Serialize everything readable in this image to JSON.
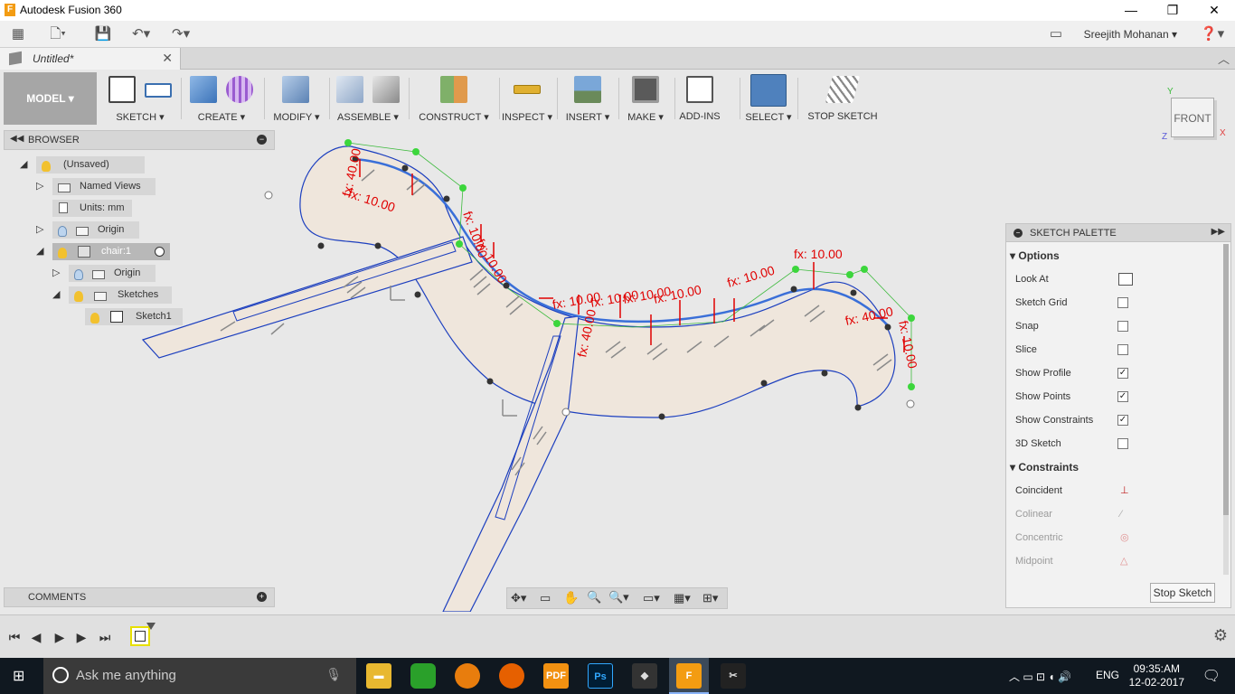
{
  "window": {
    "title": "Autodesk Fusion 360",
    "app_icon": "F",
    "minimize": "—",
    "maximize": "❐",
    "close": "✕"
  },
  "user": {
    "name": "Sreejith Mohanan"
  },
  "document_tab": {
    "name": "Untitled*"
  },
  "ribbon": {
    "workspace": "MODEL",
    "groups": [
      {
        "label": "SKETCH",
        "dropdown": true
      },
      {
        "label": "CREATE",
        "dropdown": true
      },
      {
        "label": "MODIFY",
        "dropdown": true
      },
      {
        "label": "ASSEMBLE",
        "dropdown": true
      },
      {
        "label": "CONSTRUCT",
        "dropdown": true
      },
      {
        "label": "INSPECT",
        "dropdown": true
      },
      {
        "label": "INSERT",
        "dropdown": true
      },
      {
        "label": "MAKE",
        "dropdown": true
      },
      {
        "label": "ADD-INS",
        "dropdown": false
      },
      {
        "label": "SELECT",
        "dropdown": true
      },
      {
        "label": "STOP SKETCH",
        "dropdown": false
      }
    ]
  },
  "browser": {
    "title": "BROWSER",
    "items": [
      {
        "label": "(Unsaved)"
      },
      {
        "label": "Named Views"
      },
      {
        "label": "Units: mm"
      },
      {
        "label": "Origin"
      },
      {
        "label": "chair:1"
      },
      {
        "label": "Origin"
      },
      {
        "label": "Sketches"
      },
      {
        "label": "Sketch1"
      }
    ]
  },
  "comments": {
    "title": "COMMENTS"
  },
  "viewcube": {
    "face": "FRONT",
    "axis_y": "Y",
    "axis_x": "X",
    "axis_z": "Z"
  },
  "canvas": {
    "dimensions": [
      "fx: 40.00",
      "fx: 10.00",
      "fx: 10.00",
      "fx: 10.00",
      "fx: 10.00",
      "fx: 10.00",
      "fx: 10.00",
      "fx: 10.00",
      "fx: 40.00",
      "fx: 10.00",
      "fx: 10.00",
      "fx: 40.00",
      "fx: 10.00"
    ]
  },
  "sketch_palette": {
    "title": "SKETCH PALETTE",
    "options_title": "Options",
    "options": [
      {
        "label": "Look At",
        "type": "button"
      },
      {
        "label": "Sketch Grid",
        "checked": false
      },
      {
        "label": "Snap",
        "checked": false
      },
      {
        "label": "Slice",
        "checked": false
      },
      {
        "label": "Show Profile",
        "checked": true
      },
      {
        "label": "Show Points",
        "checked": true
      },
      {
        "label": "Show Constraints",
        "checked": true
      },
      {
        "label": "3D Sketch",
        "checked": false
      }
    ],
    "constraints_title": "Constraints",
    "constraints": [
      {
        "label": "Coincident",
        "enabled": true
      },
      {
        "label": "Colinear",
        "enabled": false
      },
      {
        "label": "Concentric",
        "enabled": false
      },
      {
        "label": "Midpoint",
        "enabled": false
      }
    ],
    "stop_button": "Stop Sketch"
  },
  "taskbar": {
    "search_placeholder": "Ask me anything",
    "language": "ENG",
    "time": "09:35:AM",
    "date": "12-02-2017"
  },
  "colors": {
    "accent_blue": "#4f81bd",
    "sketch_line": "#1c3fbf",
    "dimension_red": "#e00000",
    "profile_fill": "#efe6dc"
  }
}
